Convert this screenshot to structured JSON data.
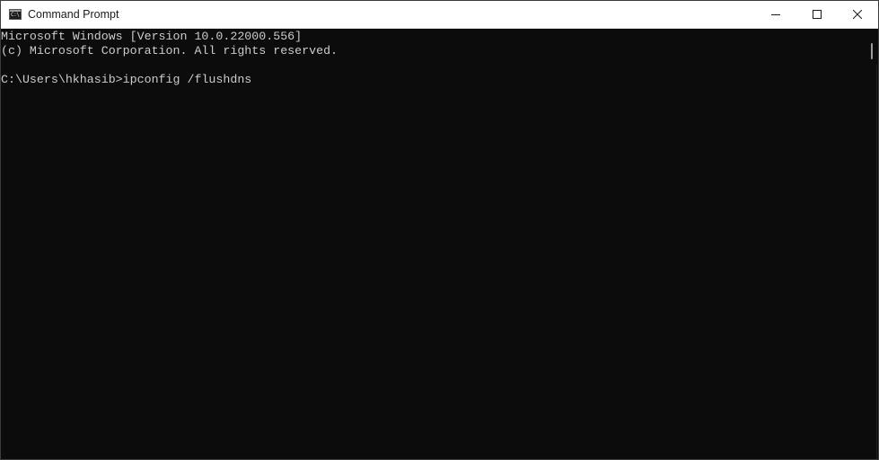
{
  "window": {
    "title": "Command Prompt",
    "app_icon": "cmd-icon",
    "app_icon_text": "C:\\"
  },
  "caption_buttons": {
    "minimize": "minimize-icon",
    "maximize": "maximize-icon",
    "close": "close-icon"
  },
  "console": {
    "lines": [
      "Microsoft Windows [Version 10.0.22000.556]",
      "(c) Microsoft Corporation. All rights reserved.",
      "",
      "C:\\Users\\hkhasib>ipconfig /flushdns"
    ],
    "text_color": "#cccccc",
    "background_color": "#0c0c0c"
  }
}
